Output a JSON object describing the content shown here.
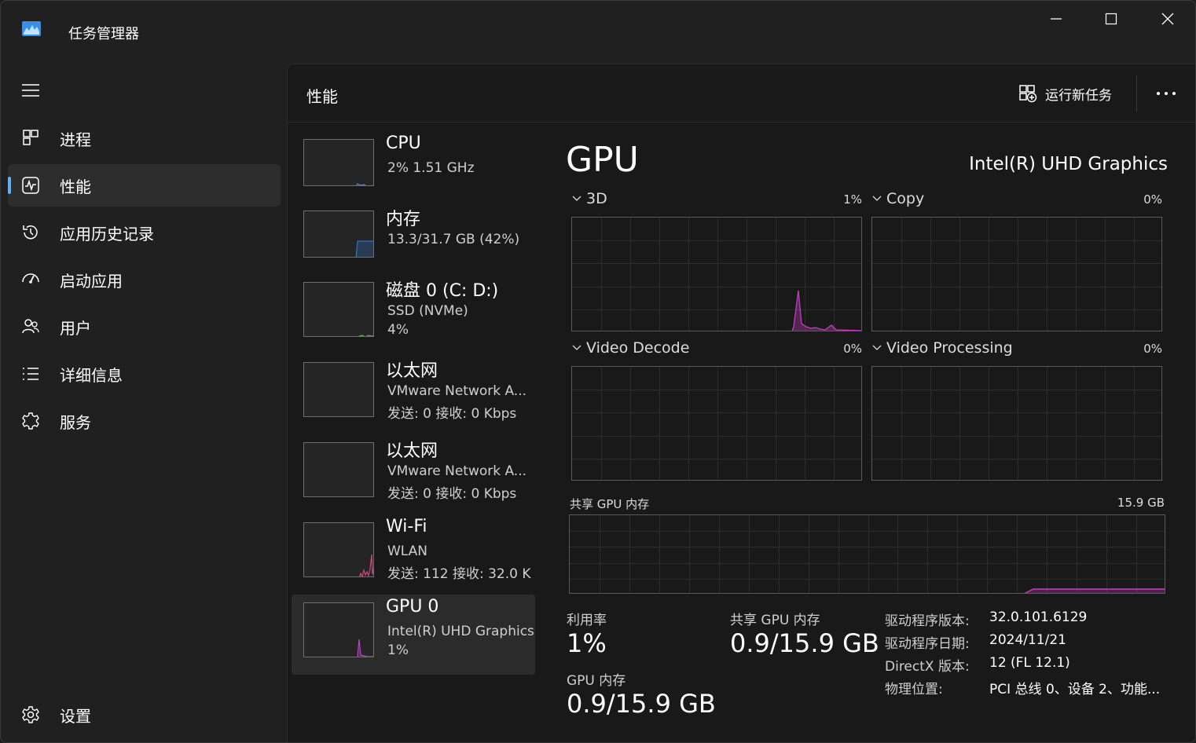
{
  "window": {
    "title": "任务管理器"
  },
  "sidebar": {
    "items": [
      {
        "label": "进程",
        "icon": "processes-icon"
      },
      {
        "label": "性能",
        "icon": "performance-icon",
        "active": true
      },
      {
        "label": "应用历史记录",
        "icon": "history-icon"
      },
      {
        "label": "启动应用",
        "icon": "startup-icon"
      },
      {
        "label": "用户",
        "icon": "users-icon"
      },
      {
        "label": "详细信息",
        "icon": "details-icon"
      },
      {
        "label": "服务",
        "icon": "services-icon"
      }
    ],
    "settings_label": "设置"
  },
  "header": {
    "title": "性能",
    "run_task_label": "运行新任务"
  },
  "devices": [
    {
      "name": "CPU",
      "line1": "2%  1.51 GHz",
      "line2": ""
    },
    {
      "name": "内存",
      "line1": "13.3/31.7 GB (42%)",
      "line2": ""
    },
    {
      "name": "磁盘 0 (C: D:)",
      "line1": "SSD (NVMe)",
      "line2": "4%"
    },
    {
      "name": "以太网",
      "line1": "VMware Network A...",
      "line2": "发送: 0  接收: 0 Kbps"
    },
    {
      "name": "以太网",
      "line1": "VMware Network A...",
      "line2": "发送: 0  接收: 0 Kbps"
    },
    {
      "name": "Wi-Fi",
      "line1": "WLAN",
      "line2": "发送: 112  接收: 32.0 K"
    },
    {
      "name": "GPU 0",
      "line1": "Intel(R) UHD Graphics",
      "line2": "1%",
      "active": true
    }
  ],
  "gpu": {
    "title": "GPU",
    "model": "Intel(R) UHD Graphics",
    "engines": [
      {
        "name": "3D",
        "percent": "1%",
        "value": 1
      },
      {
        "name": "Copy",
        "percent": "0%",
        "value": 0
      },
      {
        "name": "Video Decode",
        "percent": "0%",
        "value": 0
      },
      {
        "name": "Video Processing",
        "percent": "0%",
        "value": 0
      }
    ],
    "shared_memory": {
      "label": "共享 GPU 内存",
      "max": "15.9 GB"
    },
    "stats": {
      "utilization_label": "利用率",
      "utilization_value": "1%",
      "shared_mem_label": "共享 GPU 内存",
      "shared_mem_value": "0.9/15.9 GB",
      "gpu_mem_label": "GPU 内存",
      "gpu_mem_value": "0.9/15.9 GB"
    },
    "info": [
      {
        "key": "驱动程序版本:",
        "value": "32.0.101.6129"
      },
      {
        "key": "驱动程序日期:",
        "value": "2024/11/21"
      },
      {
        "key": "DirectX 版本:",
        "value": "12 (FL 12.1)"
      },
      {
        "key": "物理位置:",
        "value": "PCI 总线 0、设备 2、功能..."
      }
    ]
  },
  "colors": {
    "accent": "#5fb2f2",
    "gpu_line": "#c13ec1",
    "cpu_line": "#3c9bd8",
    "memory_line": "#2f74c0",
    "disk_line": "#4cbc3c",
    "wifi_line": "#d0487a"
  }
}
